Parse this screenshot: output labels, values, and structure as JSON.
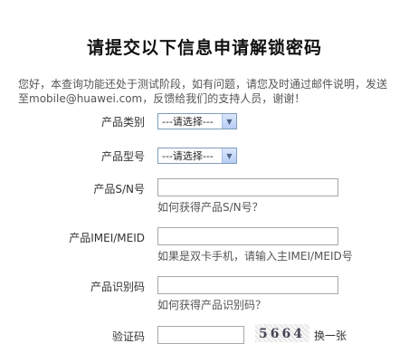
{
  "page": {
    "title": "请提交以下信息申请解锁密码",
    "intro": "您好，本查询功能还处于测试阶段，如有问题，请您及时通过邮件说明，发送至mobile@huawei.com，反馈给我们的支持人员，谢谢！"
  },
  "form": {
    "category_label": "产品类别",
    "category_value": "---请选择---",
    "model_label": "产品型号",
    "model_value": "---请选择---",
    "sn_label": "产品S/N号",
    "sn_value": "",
    "sn_hint": "如何获得产品S/N号？",
    "imei_label": "产品IMEI/MEID",
    "imei_value": "",
    "imei_hint": "如果是双卡手机，请输入主IMEI/MEID号",
    "id_label": "产品识别码",
    "id_value": "",
    "id_hint": "如何获得产品识别码？",
    "captcha_label": "验证码",
    "captcha_value": "",
    "captcha_text": "5664",
    "captcha_refresh": "换一张"
  }
}
